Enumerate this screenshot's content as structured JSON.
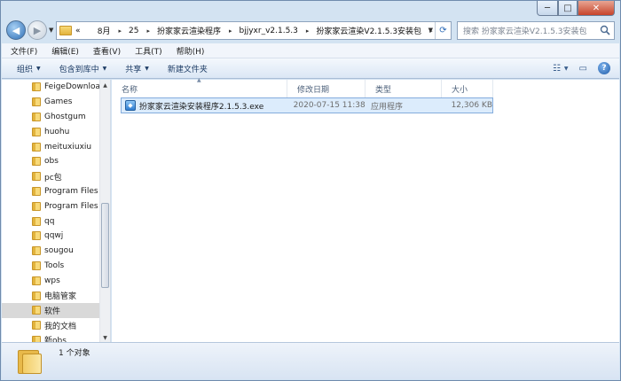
{
  "window": {
    "minimize_glyph": "─",
    "maximize_glyph": "□",
    "close_glyph": "✕"
  },
  "address": {
    "overflow": "«",
    "crumbs": [
      "8月",
      "25",
      "扮家家云渲染程序",
      "bjjyxr_v2.1.5.3",
      "扮家家云渲染V2.1.5.3安装包"
    ],
    "search_placeholder": "搜索 扮家家云渲染V2.1.5.3安装包"
  },
  "menu": {
    "file": "文件(F)",
    "edit": "编辑(E)",
    "view": "查看(V)",
    "tools": "工具(T)",
    "help": "帮助(H)"
  },
  "toolbar": {
    "organize": "组织",
    "include_in_library": "包含到库中",
    "share": "共享",
    "new_folder": "新建文件夹"
  },
  "nav": {
    "items": [
      "FeigeDownloa",
      "Games",
      "Ghostgum",
      "huohu",
      "meituxiuxiu",
      "obs",
      "pc包",
      "Program Files",
      "Program Files",
      "qq",
      "qqwj",
      "sougou",
      "Tools",
      "wps",
      "电脑管家",
      "软件",
      "我的文档",
      "新obs"
    ],
    "selected_index": 15
  },
  "columns": {
    "name": "名称",
    "modified": "修改日期",
    "type": "类型",
    "size": "大小"
  },
  "files": [
    {
      "name": "扮家家云渲染安装程序2.1.5.3.exe",
      "modified": "2020-07-15 11:38",
      "type": "应用程序",
      "size": "12,306 KB"
    }
  ],
  "status": {
    "count_text": "1 个对象"
  },
  "colors": {
    "selection_bg": "#dcecfc",
    "selection_border": "#84acdd",
    "close_button": "#c7442b"
  },
  "icons": [
    "back-arrow-icon",
    "forward-arrow-icon",
    "folder-icon",
    "refresh-icon",
    "search-icon",
    "view-options-icon",
    "preview-pane-icon",
    "help-icon",
    "exe-file-icon"
  ]
}
